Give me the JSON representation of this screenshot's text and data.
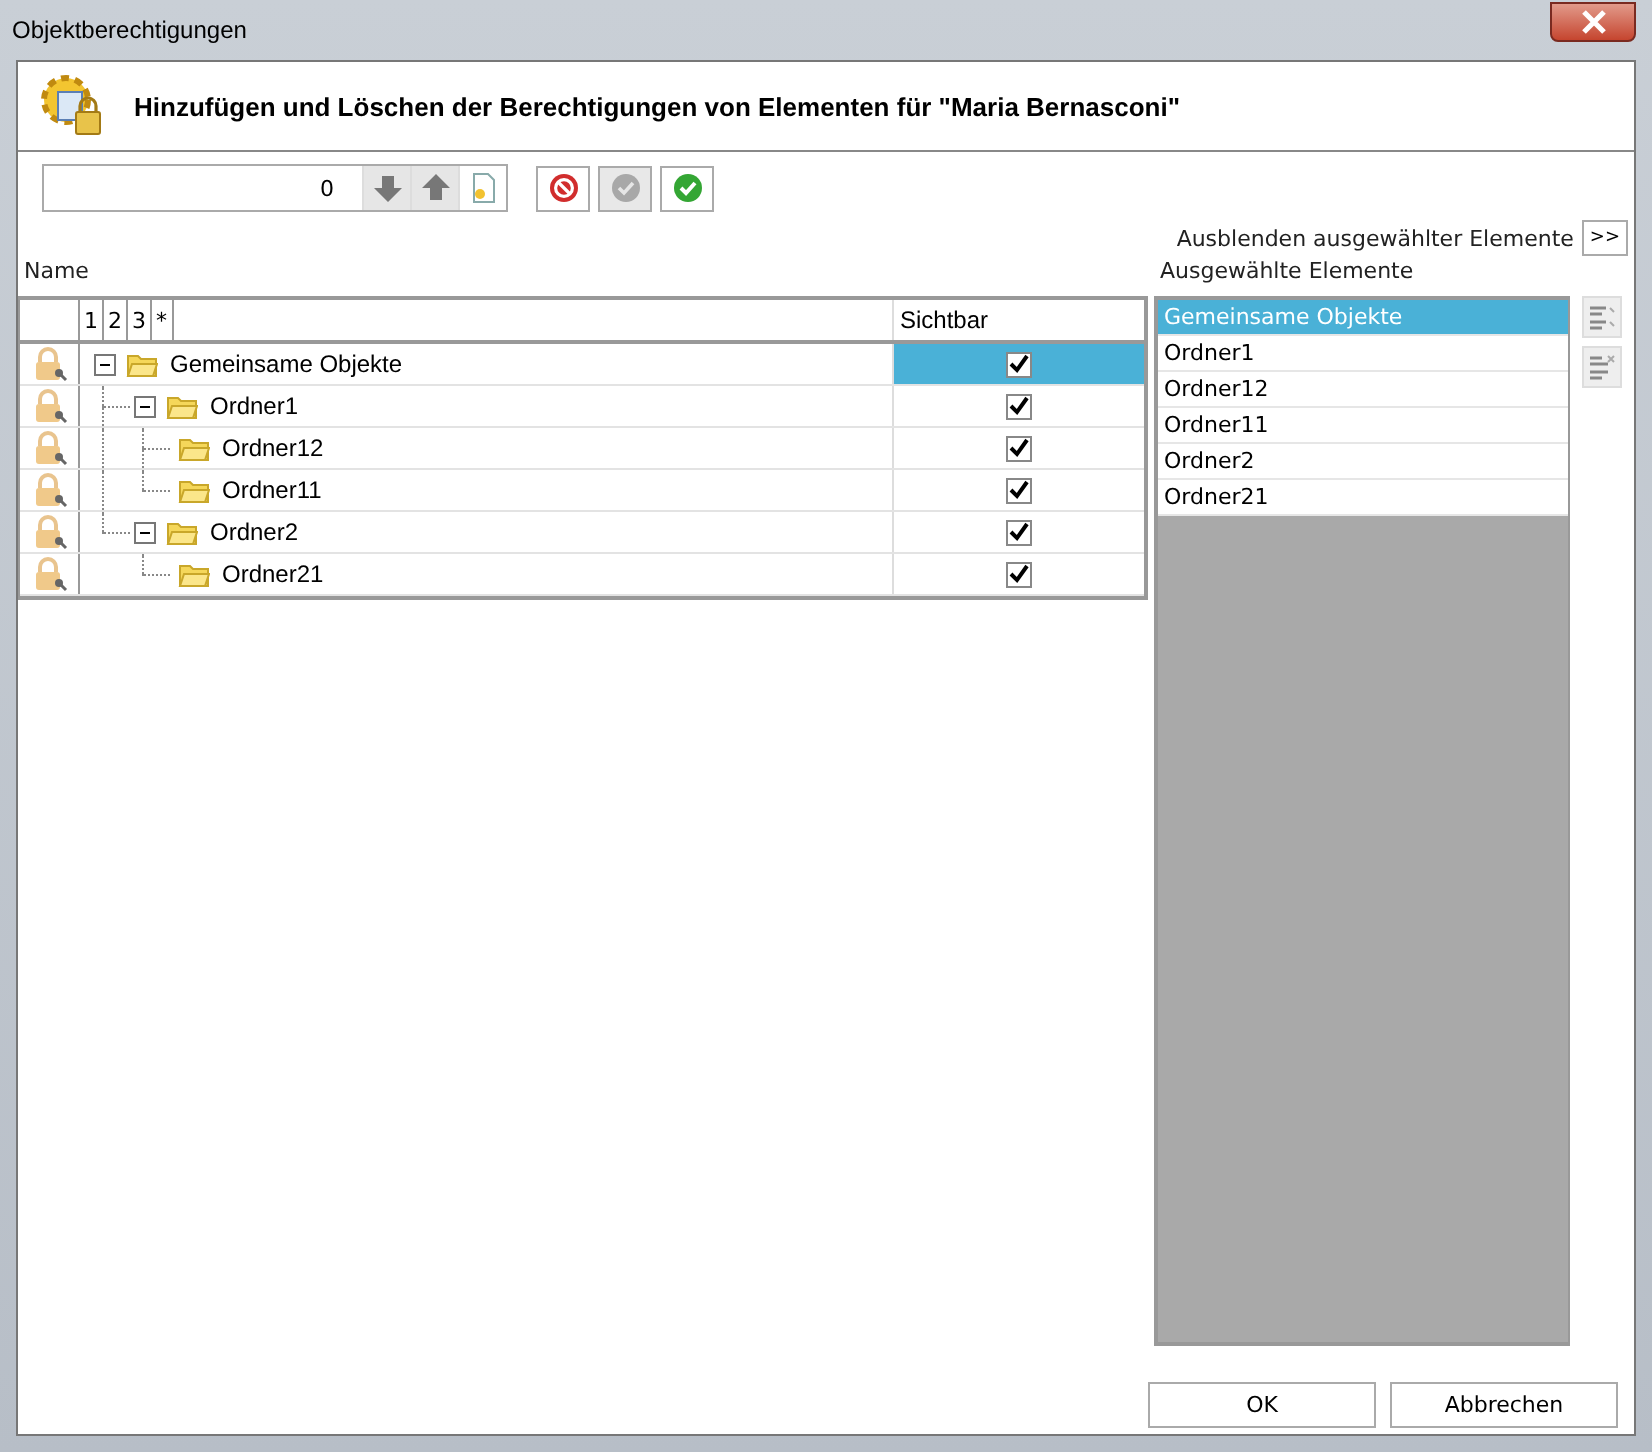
{
  "window": {
    "title": "Objektberechtigungen"
  },
  "header": {
    "title": "Hinzufügen und Löschen der Berechtigungen von Elementen für \"Maria Bernasconi\""
  },
  "toolbar": {
    "value": "0"
  },
  "hide_selected": {
    "label": "Ausblenden ausgewählter Elemente",
    "button": ">>"
  },
  "tree": {
    "label": "Name",
    "level_buttons": [
      "1",
      "2",
      "3",
      "*"
    ],
    "column": "Sichtbar",
    "rows": [
      {
        "name": "Gemeinsame Objekte",
        "expanded": true,
        "checked": true,
        "selected": true,
        "children": [
          {
            "name": "Ordner1",
            "expanded": true,
            "checked": true,
            "selected": false,
            "children": [
              {
                "name": "Ordner12",
                "checked": true,
                "selected": false
              },
              {
                "name": "Ordner11",
                "checked": true,
                "selected": false
              }
            ]
          },
          {
            "name": "Ordner2",
            "expanded": true,
            "checked": true,
            "selected": false,
            "children": [
              {
                "name": "Ordner21",
                "checked": true,
                "selected": false
              }
            ]
          }
        ]
      }
    ]
  },
  "selected_list": {
    "label": "Ausgewählte Elemente",
    "items": [
      {
        "name": "Gemeinsame Objekte",
        "selected": true
      },
      {
        "name": "Ordner1",
        "selected": false
      },
      {
        "name": "Ordner12",
        "selected": false
      },
      {
        "name": "Ordner11",
        "selected": false
      },
      {
        "name": "Ordner2",
        "selected": false
      },
      {
        "name": "Ordner21",
        "selected": false
      }
    ]
  },
  "buttons": [
    "OK",
    "Abbrechen"
  ]
}
